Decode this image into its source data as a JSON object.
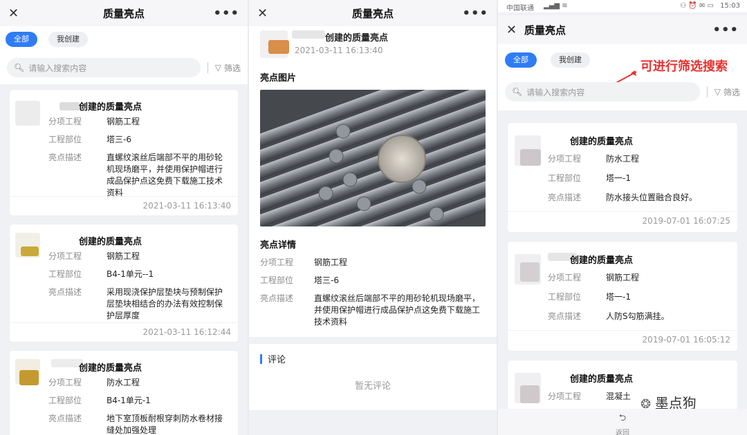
{
  "panel1": {
    "title": "质量亮点",
    "tabs": [
      "全部",
      "我创建"
    ],
    "search_placeholder": "请输入搜索内容",
    "filter_label": "筛选",
    "cards": [
      {
        "title": "创建的质量亮点",
        "fields": [
          {
            "label": "分项工程",
            "value": "钢筋工程"
          },
          {
            "label": "工程部位",
            "value": "塔三-6"
          },
          {
            "label": "亮点描述",
            "value": "直螺纹滚丝后端部不平的用砂轮机现场磨平，并使用保护帽进行成品保护点这免费下载施工技术资料"
          }
        ],
        "time": "2021-03-11 16:13:40"
      },
      {
        "title": "创建的质量亮点",
        "fields": [
          {
            "label": "分项工程",
            "value": "钢筋工程"
          },
          {
            "label": "工程部位",
            "value": "B4-1单元--1"
          },
          {
            "label": "亮点描述",
            "value": "采用现浇保护层垫块与预制保护层垫块相结合的办法有效控制保护层厚度"
          }
        ],
        "time": "2021-03-11 16:12:44"
      },
      {
        "title": "创建的质量亮点",
        "fields": [
          {
            "label": "分项工程",
            "value": "防水工程"
          },
          {
            "label": "工程部位",
            "value": "B4-1单元-1"
          },
          {
            "label": "亮点描述",
            "value": "地下室顶板耐根穿刺防水卷材接缝处加强处理"
          }
        ],
        "time": ""
      }
    ]
  },
  "panel2": {
    "title": "质量亮点",
    "header_title": "创建的质量亮点",
    "header_time": "2021-03-11 16:13:40",
    "photo_heading": "亮点图片",
    "detail_heading": "亮点详情",
    "fields": [
      {
        "label": "分项工程",
        "value": "钢筋工程"
      },
      {
        "label": "工程部位",
        "value": "塔三-6"
      },
      {
        "label": "亮点描述",
        "value": "直螺纹滚丝后端部不平的用砂轮机现场磨平，并使用保护帽进行成品保护点这免费下载施工技术资料"
      }
    ],
    "comment_heading": "评论",
    "no_comment": "暂无评论"
  },
  "panel3": {
    "carrier": "中国联通",
    "clock": "15:03",
    "title": "质量亮点",
    "tabs": [
      "全部",
      "我创建"
    ],
    "annotation": "可进行筛选搜索",
    "search_placeholder": "请输入搜索内容",
    "filter_label": "筛选",
    "cards": [
      {
        "title": "创建的质量亮点",
        "fields": [
          {
            "label": "分项工程",
            "value": "防水工程"
          },
          {
            "label": "工程部位",
            "value": "塔一-1"
          },
          {
            "label": "亮点描述",
            "value": "防水接头位置融合良好。"
          }
        ],
        "time": "2019-07-01 16:07:25"
      },
      {
        "title": "创建的质量亮点",
        "fields": [
          {
            "label": "分项工程",
            "value": "钢筋工程"
          },
          {
            "label": "工程部位",
            "value": "塔一-1"
          },
          {
            "label": "亮点描述",
            "value": "人防S勾筋满挂。"
          }
        ],
        "time": "2019-07-01 16:05:12"
      },
      {
        "title": "创建的质量亮点",
        "fields": [
          {
            "label": "分项工程",
            "value": "混凝土"
          }
        ],
        "time": ""
      }
    ],
    "watermark": "墨点狗",
    "back_label": "返回"
  },
  "colors": {
    "accent": "#2f7cf6",
    "annotation": "#e8322e"
  }
}
